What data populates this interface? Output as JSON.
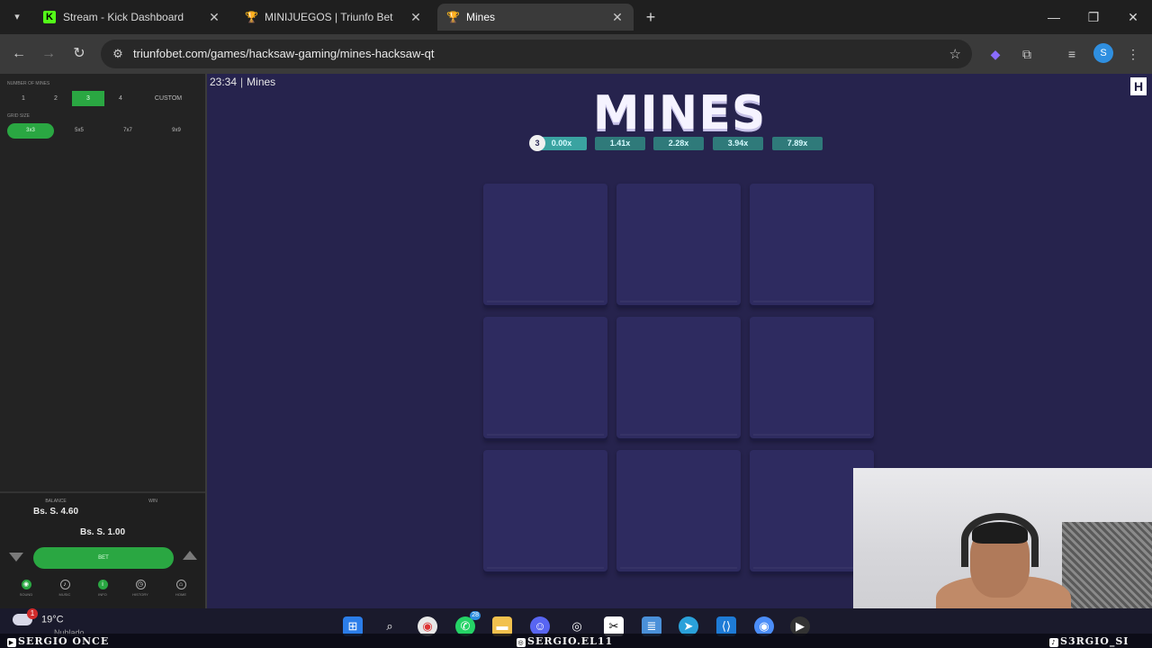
{
  "browser": {
    "tabs": [
      {
        "title": "Stream - Kick Dashboard",
        "icon": "kick-logo-icon"
      },
      {
        "title": "MINIJUEGOS | Triunfo Bet",
        "icon": "trophy-icon"
      },
      {
        "title": "Mines",
        "icon": "trophy-icon"
      }
    ],
    "url": "triunfobet.com/games/hacksaw-gaming/mines-hacksaw-qt"
  },
  "sidebar": {
    "mines_label": "NUMBER OF MINES",
    "mines_options": [
      "1",
      "2",
      "3",
      "4",
      "CUSTOM"
    ],
    "mines_selected": "3",
    "grid_label": "GRID SIZE",
    "grid_options": [
      "3x3",
      "5x5",
      "7x7",
      "9x9"
    ],
    "grid_selected": "3x3",
    "balance_label": "BALANCE",
    "balance_value": "Bs. S. 4.60",
    "win_label": "WIN",
    "bet_amount": "Bs. S. 1.00",
    "bet_button": "BET",
    "nav": [
      "SOUND",
      "MUSIC",
      "INFO",
      "HISTORY",
      "HOME"
    ]
  },
  "game": {
    "clock": "23:34",
    "name": "Mines",
    "title": "MINES",
    "knob_value": "3",
    "multipliers": [
      "0.00x",
      "1.41x",
      "2.28x",
      "3.94x",
      "7.89x"
    ],
    "tiles": 9,
    "brand_mark": "H"
  },
  "taskbar": {
    "temperature": "19°C",
    "weather_sub": "Nublado",
    "weather_badge": "1",
    "whatsapp_count": "28"
  },
  "overlay": {
    "left": "SERGIO ONCE",
    "center": "SERGIO.EL11",
    "right": "S3RGIO_SI"
  },
  "colors": {
    "accent_green": "#2aa742",
    "game_bg": "#26234d",
    "tile": "#2e2b60",
    "multiplier": "#2f7a7a"
  }
}
